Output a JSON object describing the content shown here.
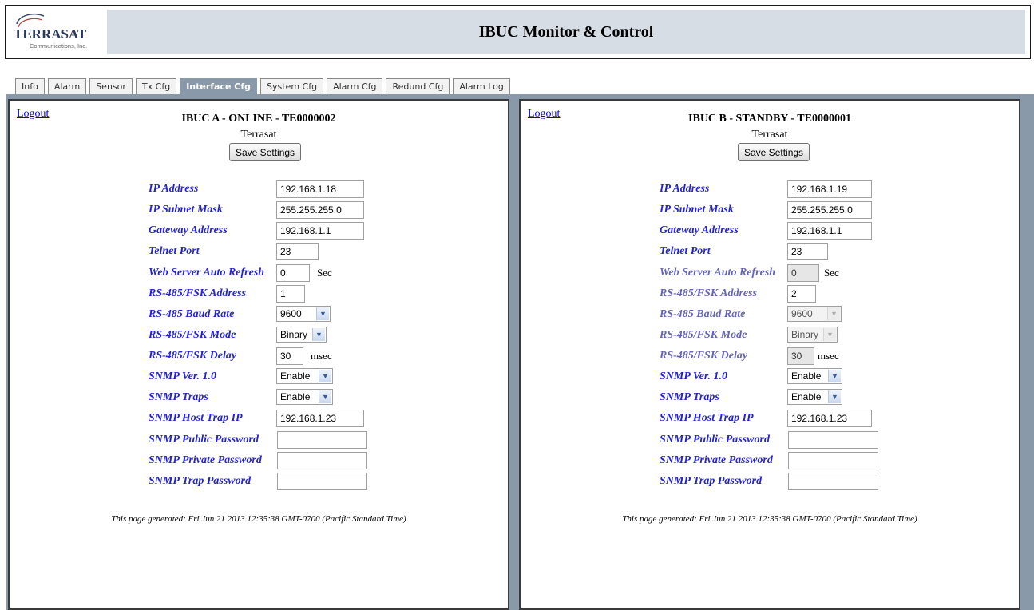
{
  "header": {
    "logo_text": "TERRASAT",
    "logo_sub": "Communications, Inc.",
    "title": "IBUC Monitor & Control"
  },
  "tabs": [
    {
      "label": "Info"
    },
    {
      "label": "Alarm"
    },
    {
      "label": "Sensor"
    },
    {
      "label": "Tx Cfg"
    },
    {
      "label": "Interface Cfg"
    },
    {
      "label": "System Cfg"
    },
    {
      "label": "Alarm Cfg"
    },
    {
      "label": "Redund Cfg"
    },
    {
      "label": "Alarm Log"
    }
  ],
  "active_tab": "Interface Cfg",
  "labels": {
    "ip_address": "IP Address",
    "subnet_mask": "IP Subnet Mask",
    "gateway": "Gateway Address",
    "telnet_port": "Telnet Port",
    "auto_refresh": "Web Server Auto Refresh",
    "rs485_address": "RS-485/FSK Address",
    "rs485_baud": "RS-485 Baud Rate",
    "rs485_mode": "RS-485/FSK Mode",
    "rs485_delay": "RS-485/FSK Delay",
    "snmp_ver": "SNMP Ver. 1.0",
    "snmp_traps": "SNMP Traps",
    "snmp_host": "SNMP Host Trap IP",
    "snmp_public": "SNMP Public Password",
    "snmp_private": "SNMP Private Password",
    "snmp_trap_pw": "SNMP Trap Password"
  },
  "units": {
    "sec": "Sec",
    "msec": "msec"
  },
  "panel_a": {
    "logout": "Logout",
    "title": "IBUC A - ONLINE - TE0000002",
    "subtitle": "Terrasat",
    "save_label": "Save Settings",
    "ip_address": "192.168.1.18",
    "subnet_mask": "255.255.255.0",
    "gateway": "192.168.1.1",
    "telnet_port": "23",
    "auto_refresh": "0",
    "rs485_address": "1",
    "rs485_baud": "9600",
    "rs485_mode": "Binary",
    "rs485_delay": "30",
    "snmp_ver": "Enable",
    "snmp_traps": "Enable",
    "snmp_host": "192.168.1.23",
    "snmp_public": "",
    "snmp_private": "",
    "snmp_trap_pw": "",
    "footer": "This page generated: Fri Jun 21 2013 12:35:38 GMT-0700 (Pacific Standard Time)"
  },
  "panel_b": {
    "logout": "Logout",
    "title": "IBUC B - STANDBY - TE0000001",
    "subtitle": "Terrasat",
    "save_label": "Save Settings",
    "ip_address": "192.168.1.19",
    "subnet_mask": "255.255.255.0",
    "gateway": "192.168.1.1",
    "telnet_port": "23",
    "auto_refresh": "0",
    "rs485_address": "2",
    "rs485_baud": "9600",
    "rs485_mode": "Binary",
    "rs485_delay": "30",
    "snmp_ver": "Enable",
    "snmp_traps": "Enable",
    "snmp_host": "192.168.1.23",
    "snmp_public": "",
    "snmp_private": "",
    "snmp_trap_pw": "",
    "footer": "This page generated: Fri Jun 21 2013 12:35:38 GMT-0700 (Pacific Standard Time)"
  },
  "colors": {
    "title_bar": "#d6dde4",
    "frame": "#8a99aa",
    "label": "#2323d0",
    "link": "#0000ee"
  }
}
